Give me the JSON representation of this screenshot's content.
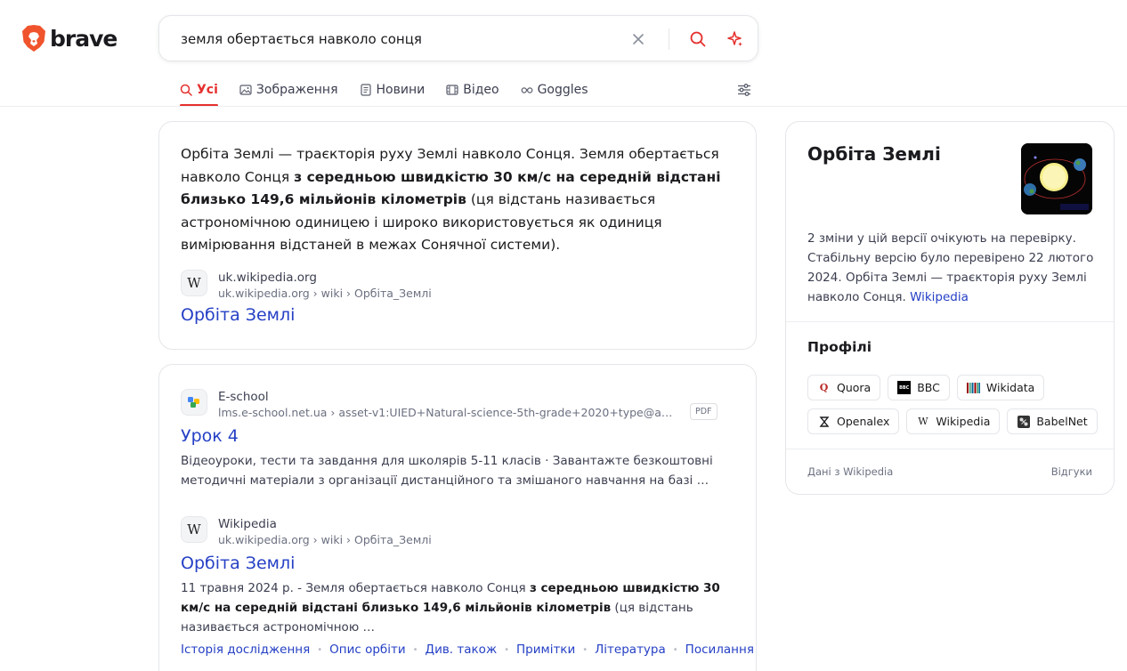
{
  "brand": {
    "name": "brave",
    "accent": "#e5302e",
    "link_color": "#2540c5"
  },
  "search": {
    "query": "земля обертається навколо сонця"
  },
  "tabs": [
    {
      "label": "Усі",
      "icon": "search-icon",
      "active": true
    },
    {
      "label": "Зображення",
      "icon": "image-icon"
    },
    {
      "label": "Новини",
      "icon": "news-icon"
    },
    {
      "label": "Відео",
      "icon": "film-icon"
    },
    {
      "label": "Goggles",
      "icon": "goggles-icon"
    }
  ],
  "snippet": {
    "text_before": "Орбіта Землі — траєкторія руху Землі навколо Сонця. Земля обертається навколо Сонця ",
    "text_bold": "з середньою швидкістю 30 км/с на середній відстані близько 149,6 мільйонів кілометрів",
    "text_after": " (ця відстань називається астрономічною одиницею і широко використовується як одиниця вимірювання відстаней в межах Сонячної системи).",
    "source_name": "uk.wikipedia.org",
    "source_url": "uk.wikipedia.org › wiki › Орбіта_Землі",
    "title": "Орбіта Землі"
  },
  "results": [
    {
      "source_name": "E-school",
      "source_url": "lms.e-school.net.ua › asset-v1:UIED+Natural-science-5th-grade+2020+type@ass…",
      "badge": "PDF",
      "title": "Урок 4",
      "desc": "Відеоуроки, тести та завдання для школярів 5-11 класів · Завантажте безкоштовні методичні матеріали з організації дистанційного та змішаного навчання на базі …"
    },
    {
      "source_name": "Wikipedia",
      "source_url": "uk.wikipedia.org › wiki › Орбіта_Землі",
      "title": "Орбіта Землі",
      "desc_before": "11 травня 2024 р. - Земля обертається навколо Сонця ",
      "desc_bold": "з середньою швидкістю 30 км/с на середній відстані близько 149,6 мільйонів кілометрів",
      "desc_after": " (ця відстань називається астрономічною …",
      "deep_links": [
        "Історія дослідження",
        "Опис орбіти",
        "Див. також",
        "Примітки",
        "Література",
        "Посилання"
      ]
    }
  ],
  "knowledge_panel": {
    "title": "Орбіта Землі",
    "desc": "2 зміни у цій версії очікують на перевірку. Стабільну версію було перевірено 22 лютого 2024. Орбіта Землі — траєкторія руху Землі навколо Сонця.",
    "desc_link": "Wikipedia",
    "profiles_title": "Профілі",
    "profiles": [
      {
        "label": "Quora",
        "icon": "quora-icon"
      },
      {
        "label": "BBC",
        "icon": "bbc-icon"
      },
      {
        "label": "Wikidata",
        "icon": "wikidata-icon"
      },
      {
        "label": "Openalex",
        "icon": "openalex-icon"
      },
      {
        "label": "Wikipedia",
        "icon": "wikipedia-icon"
      },
      {
        "label": "BabelNet",
        "icon": "babelnet-icon"
      }
    ],
    "footer_left": "Дані з Wikipedia",
    "footer_right": "Відгуки"
  }
}
